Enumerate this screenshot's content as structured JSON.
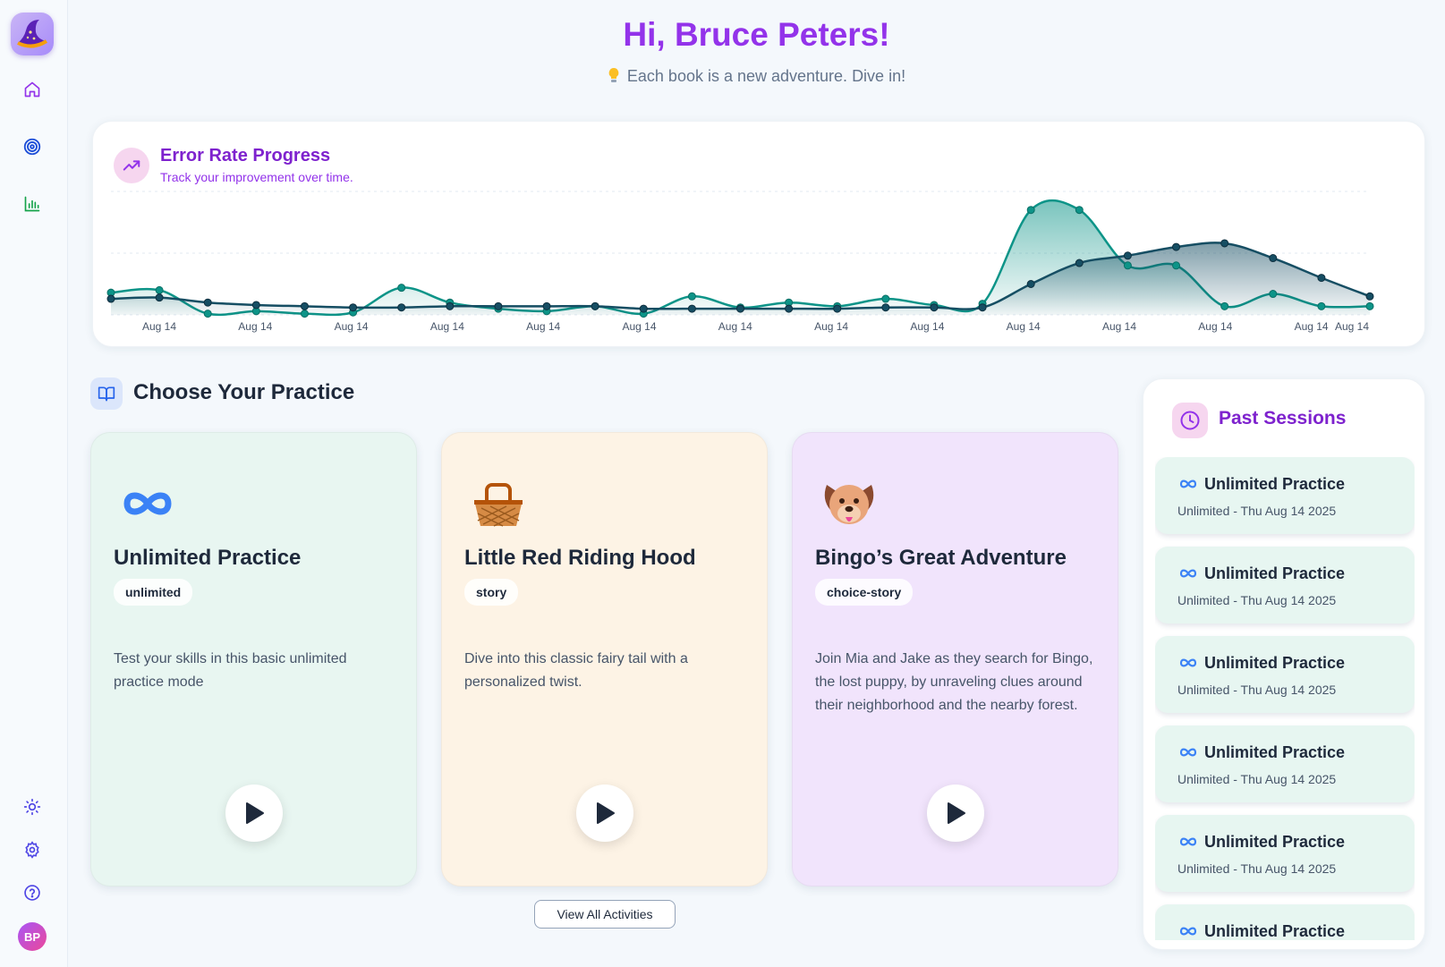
{
  "header": {
    "greeting": "Hi, Bruce Peters!",
    "tagline": "Each book is a new adventure. Dive in!",
    "tagline_icon": "lightbulb-icon"
  },
  "sidebar": {
    "items": [
      {
        "icon": "home-icon"
      },
      {
        "icon": "target-icon"
      },
      {
        "icon": "bar-chart-icon"
      }
    ],
    "bottom": [
      {
        "icon": "sun-icon"
      },
      {
        "icon": "gear-icon"
      },
      {
        "icon": "help-icon"
      }
    ],
    "avatar_initials": "BP"
  },
  "progress": {
    "title": "Error Rate Progress",
    "subtitle": "Track your improvement over time."
  },
  "chart_data": {
    "type": "area",
    "x_tick_labels": [
      "Aug 14",
      "Aug 14",
      "Aug 14",
      "Aug 14",
      "Aug 14",
      "Aug 14",
      "Aug 14",
      "Aug 14",
      "Aug 14",
      "Aug 14",
      "Aug 14",
      "Aug 14",
      "Aug 14",
      "Aug 14"
    ],
    "ylim": [
      0,
      1
    ],
    "grid": true,
    "series": [
      {
        "color": "#0d9488",
        "values": [
          0.18,
          0.2,
          0.01,
          0.03,
          0.01,
          0.02,
          0.22,
          0.1,
          0.05,
          0.03,
          0.07,
          0.01,
          0.15,
          0.06,
          0.1,
          0.07,
          0.13,
          0.08,
          0.09,
          0.85,
          0.85,
          0.4,
          0.4,
          0.07,
          0.17,
          0.07,
          0.07
        ]
      },
      {
        "color": "#164e63",
        "values": [
          0.13,
          0.14,
          0.1,
          0.08,
          0.07,
          0.06,
          0.06,
          0.07,
          0.07,
          0.07,
          0.07,
          0.05,
          0.05,
          0.05,
          0.05,
          0.05,
          0.06,
          0.06,
          0.06,
          0.25,
          0.42,
          0.48,
          0.55,
          0.58,
          0.46,
          0.3,
          0.15
        ]
      }
    ]
  },
  "practice": {
    "section_title": "Choose Your Practice",
    "view_all_label": "View All Activities",
    "cards": [
      {
        "title": "Unlimited Practice",
        "tag": "unlimited",
        "description": "Test your skills in this basic unlimited practice mode",
        "bg": "#e8f6f1",
        "icon": "infinity-icon"
      },
      {
        "title": "Little Red Riding Hood",
        "tag": "story",
        "description": "Dive into this classic fairy tail with a personalized twist.",
        "bg": "#fdf3e5",
        "icon": "basket-icon"
      },
      {
        "title": "Bingo’s Great Adventure",
        "tag": "choice-story",
        "description": "Join Mia and Jake as they search for Bingo, the lost puppy, by unraveling clues around their neighborhood and the nearby forest.",
        "bg": "#f1e4fc",
        "icon": "dog-face-icon"
      }
    ]
  },
  "past_sessions": {
    "title": "Past Sessions",
    "items": [
      {
        "name": "Unlimited Practice",
        "meta": "Unlimited - Thu Aug 14 2025"
      },
      {
        "name": "Unlimited Practice",
        "meta": "Unlimited - Thu Aug 14 2025"
      },
      {
        "name": "Unlimited Practice",
        "meta": "Unlimited - Thu Aug 14 2025"
      },
      {
        "name": "Unlimited Practice",
        "meta": "Unlimited - Thu Aug 14 2025"
      },
      {
        "name": "Unlimited Practice",
        "meta": "Unlimited - Thu Aug 14 2025"
      },
      {
        "name": "Unlimited Practice",
        "meta": ""
      }
    ]
  }
}
